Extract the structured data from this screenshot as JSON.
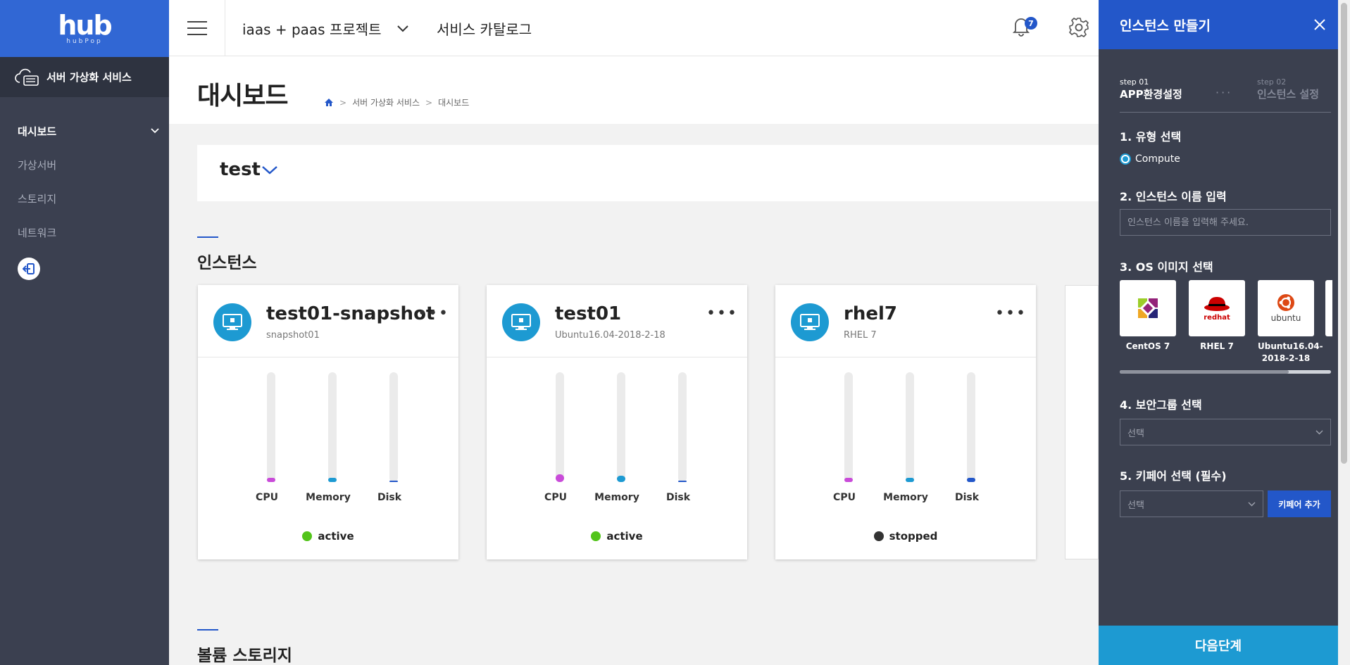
{
  "logo": {
    "text": "hub",
    "sub": "hubPop"
  },
  "sidebar": {
    "service": "서버 가상화 서비스",
    "items": [
      {
        "label": "대시보드",
        "active": true
      },
      {
        "label": "가상서버"
      },
      {
        "label": "스토리지"
      },
      {
        "label": "네트워크"
      }
    ]
  },
  "topbar": {
    "project": "iaas + paas 프로젝트",
    "catalog": "서비스 카탈로그",
    "notifications": "7"
  },
  "page": {
    "title": "대시보드",
    "breadcrumb": [
      "서버 가상화 서비스",
      "대시보드"
    ]
  },
  "project_selector": {
    "name": "test"
  },
  "sections": {
    "instances": "인스턴스",
    "volumes": "볼륨 스토리지"
  },
  "gauge_labels": [
    "CPU",
    "Memory",
    "Disk"
  ],
  "instances": [
    {
      "name": "test01-snapshot",
      "sub": "snapshot01",
      "status": "active",
      "status_color": "#52c41a",
      "cpu": 0.04,
      "memory": 0.01,
      "disk": 0.0,
      "colors": [
        "#c94bd9",
        "#1d9ad2",
        "#2357c9"
      ]
    },
    {
      "name": "test01",
      "sub": "Ubuntu16.04-2018-2-18",
      "status": "active",
      "status_color": "#52c41a",
      "cpu": 0.07,
      "memory": 0.06,
      "disk": 0.0,
      "colors": [
        "#c94bd9",
        "#1d9ad2",
        "#2357c9"
      ]
    },
    {
      "name": "rhel7",
      "sub": "RHEL 7",
      "status": "stopped",
      "status_color": "#333333",
      "cpu": 0.04,
      "memory": 0.03,
      "disk": 0.02,
      "colors": [
        "#c94bd9",
        "#1d9ad2",
        "#2357c9"
      ]
    }
  ],
  "panel": {
    "title": "인스턴스 만들기",
    "step1": {
      "num": "step 01",
      "title": "APP환경설정"
    },
    "step2": {
      "num": "step 02",
      "title": "인스턴스 설정"
    },
    "s1": "1. 유형 선택",
    "type_option": "Compute",
    "s2": "2. 인스턴스 이름 입력",
    "name_placeholder": "인스턴스 이름을 입력해 주세요.",
    "s3": "3. OS 이미지 선택",
    "os": [
      {
        "label": "CentOS 7",
        "icon": "centos-logo"
      },
      {
        "label": "RHEL 7",
        "icon": "redhat-logo",
        "logo_text": "redhat"
      },
      {
        "label": "Ubuntu16.04-2018-2-18",
        "icon": "ubuntu-logo",
        "logo_text": "ubuntu"
      }
    ],
    "os_scroll": 0.8,
    "s4": "4. 보안그룹 선택",
    "security_select": "선택",
    "s5": "5. 키페어 선택 (필수)",
    "keypair_select": "선택",
    "add_keypair": "키페어 추가",
    "next": "다음단계"
  }
}
